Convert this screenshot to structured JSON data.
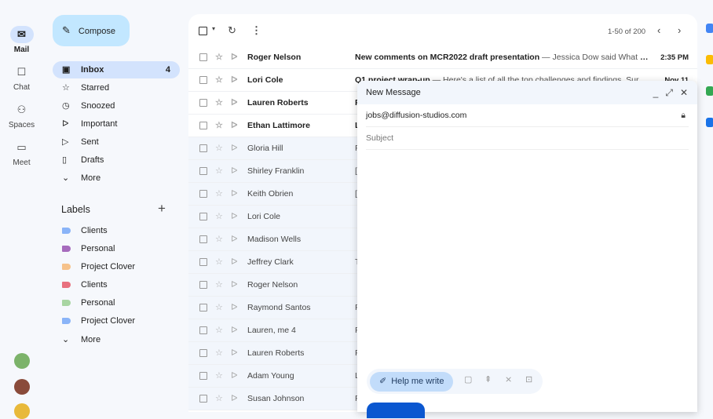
{
  "rail": [
    {
      "label": "Mail",
      "icon": "mail-icon",
      "active": true
    },
    {
      "label": "Chat",
      "icon": "chat-icon"
    },
    {
      "label": "Spaces",
      "icon": "spaces-icon"
    },
    {
      "label": "Meet",
      "icon": "video-icon"
    }
  ],
  "compose": {
    "label": "Compose"
  },
  "nav": [
    {
      "label": "Inbox",
      "icon": "inbox-icon",
      "count": "4",
      "active": true
    },
    {
      "label": "Starred",
      "icon": "star-icon"
    },
    {
      "label": "Snoozed",
      "icon": "clock-icon"
    },
    {
      "label": "Important",
      "icon": "important-icon"
    },
    {
      "label": "Sent",
      "icon": "send-icon"
    },
    {
      "label": "Drafts",
      "icon": "draft-icon"
    },
    {
      "label": "More",
      "icon": "chevron-down-icon"
    }
  ],
  "labels": {
    "title": "Labels",
    "items": [
      {
        "label": "Clients",
        "color": "#8ab4f8"
      },
      {
        "label": "Personal",
        "color": "#a66bbd"
      },
      {
        "label": "Project Clover",
        "color": "#f6c28b"
      },
      {
        "label": "Clients",
        "color": "#e8707e"
      },
      {
        "label": "Personal",
        "color": "#a8d5a2"
      },
      {
        "label": "Project Clover",
        "color": "#8ab4f8"
      }
    ],
    "more": "More"
  },
  "toolbar": {
    "pagination": "1-50 of 200"
  },
  "emails": [
    {
      "from": "Roger Nelson",
      "subject": "New comments on MCR2022 draft presentation",
      "snippet": " — Jessica Dow said What a...",
      "date": "2:35 PM",
      "unread": true
    },
    {
      "from": "Lori Cole",
      "subject": "Q1 project wrap-up",
      "snippet": " — Here's a list of all the top challenges and findings. Surp...",
      "date": "Nov 11",
      "unread": true
    },
    {
      "from": "Lauren Roberts",
      "subject": "F",
      "snippet": "",
      "date": "",
      "unread": true
    },
    {
      "from": "Ethan Lattimore",
      "subject": "L",
      "snippet": "",
      "date": "",
      "unread": true
    },
    {
      "from": "Gloria Hill",
      "subject": "",
      "snippet": "F",
      "date": ""
    },
    {
      "from": "Shirley Franklin",
      "subject": "",
      "snippet": "[",
      "date": ""
    },
    {
      "from": "Keith Obrien",
      "subject": "",
      "snippet": "[",
      "date": ""
    },
    {
      "from": "Lori Cole",
      "subject": "",
      "snippet": "",
      "date": ""
    },
    {
      "from": "Madison Wells",
      "subject": "",
      "snippet": "",
      "date": ""
    },
    {
      "from": "Jeffrey Clark",
      "subject": "",
      "snippet": "T",
      "date": ""
    },
    {
      "from": "Roger Nelson",
      "subject": "",
      "snippet": "",
      "date": ""
    },
    {
      "from": "Raymond Santos",
      "subject": "",
      "snippet": "F",
      "date": ""
    },
    {
      "from": "Lauren, me 4",
      "subject": "",
      "snippet": "F",
      "date": ""
    },
    {
      "from": "Lauren Roberts",
      "subject": "",
      "snippet": "F",
      "date": ""
    },
    {
      "from": "Adam Young",
      "subject": "",
      "snippet": "L",
      "date": ""
    },
    {
      "from": "Susan Johnson",
      "subject": "",
      "snippet": "F",
      "date": ""
    }
  ],
  "compose_window": {
    "title": "New Message",
    "to": "jobs@diffusion-studios.com",
    "subject_placeholder": "Subject",
    "help_me_write": "Help me write"
  }
}
